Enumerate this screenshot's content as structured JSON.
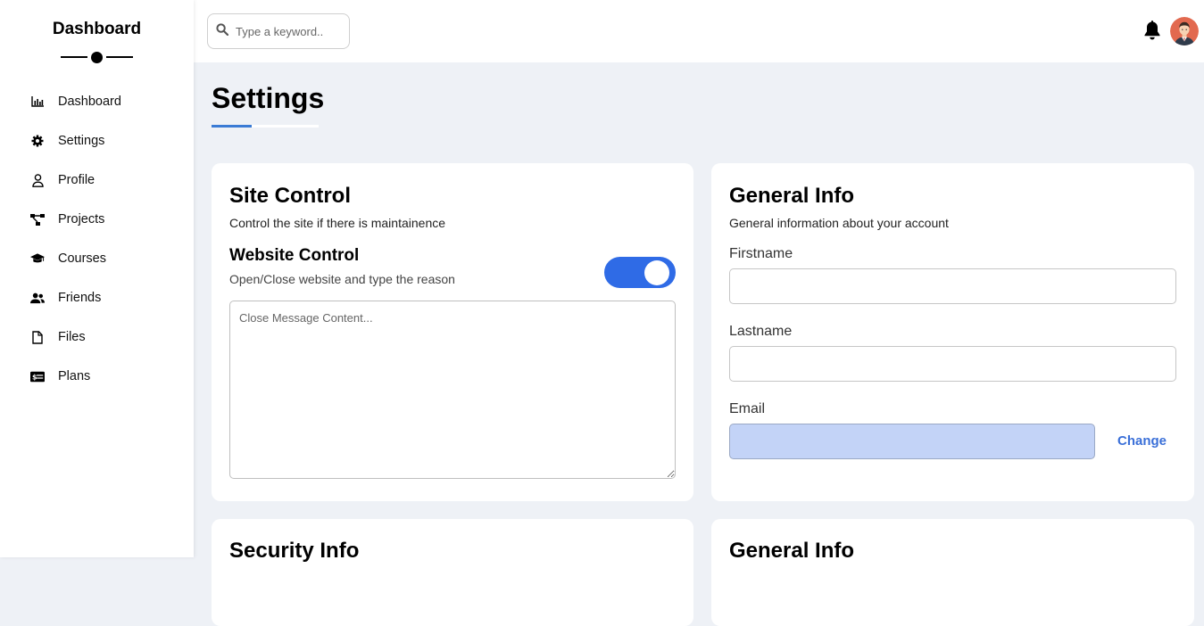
{
  "sidebar": {
    "brand": "Dashboard",
    "items": [
      {
        "label": "Dashboard",
        "icon": "chart-bar-icon"
      },
      {
        "label": "Settings",
        "icon": "gear-icon"
      },
      {
        "label": "Profile",
        "icon": "user-icon"
      },
      {
        "label": "Projects",
        "icon": "diagram-project-icon"
      },
      {
        "label": "Courses",
        "icon": "graduation-cap-icon"
      },
      {
        "label": "Friends",
        "icon": "users-icon"
      },
      {
        "label": "Files",
        "icon": "file-icon"
      },
      {
        "label": "Plans",
        "icon": "money-check-icon"
      }
    ]
  },
  "topbar": {
    "search_placeholder": "Type a keyword..",
    "icons": [
      "search-icon",
      "bell-icon",
      "avatar"
    ]
  },
  "page": {
    "title": "Settings",
    "accent_color": "#3a7bd5"
  },
  "site_control": {
    "title": "Site Control",
    "description": "Control the site if there is maintainence",
    "website_control_title": "Website Control",
    "website_control_desc": "Open/Close website and type the reason",
    "toggle_on": true,
    "toggle_color": "#2f6be6",
    "message_placeholder": "Close Message Content..."
  },
  "general_info": {
    "title": "General Info",
    "description": "General information about your account",
    "firstname_label": "Firstname",
    "lastname_label": "Lastname",
    "email_label": "Email",
    "change_label": "Change",
    "email_bg_color": "#c3d3f7"
  },
  "lower_cards": {
    "left_title": "Security Info",
    "right_title": "General Info"
  }
}
